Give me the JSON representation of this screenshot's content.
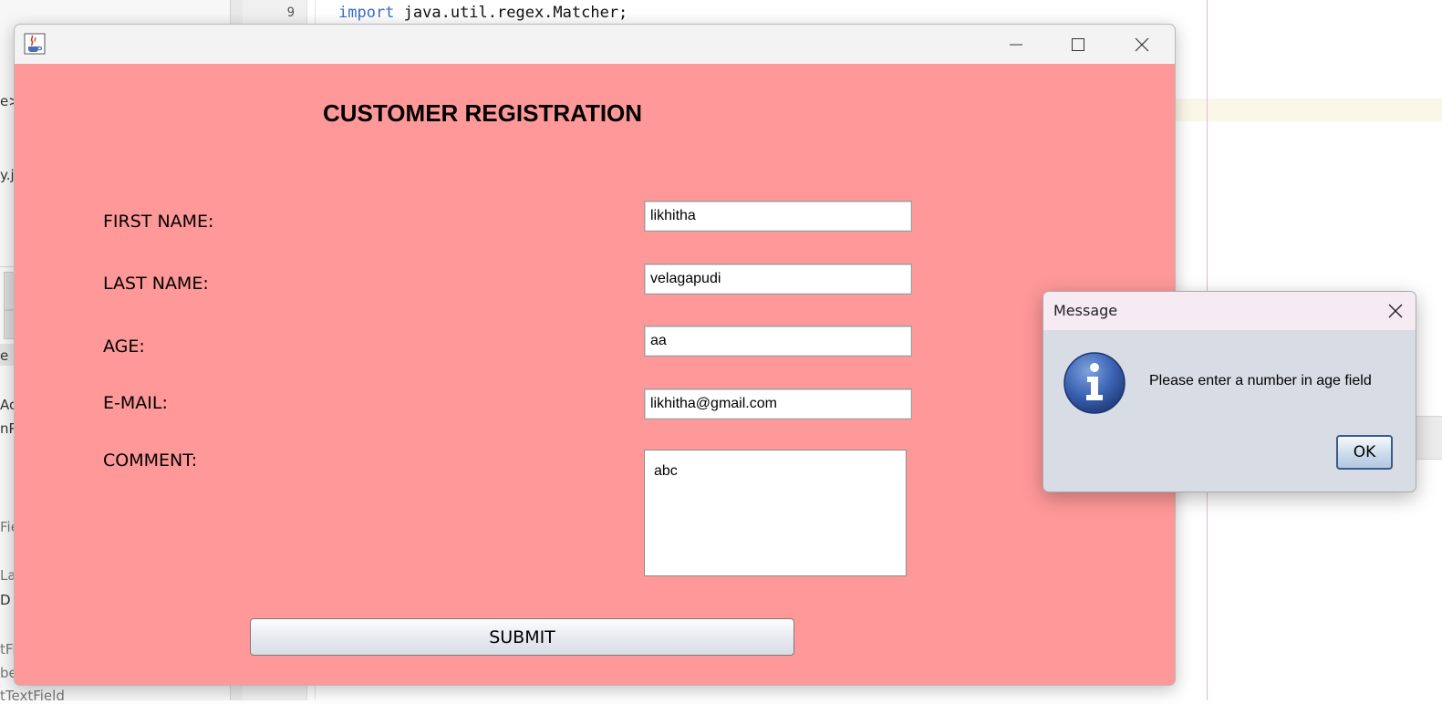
{
  "ide": {
    "left_fragments": [
      "e>",
      "y.j",
      "e",
      "Act",
      "nPa",
      "Fie",
      "Lab",
      "D",
      "tFie",
      "be",
      "tTextField"
    ],
    "line_number": "9",
    "code_keyword": "import",
    "code_rest": " java.util.regex.Matcher;"
  },
  "window": {
    "title": "",
    "icon": "java-coffee-cup-icon"
  },
  "form": {
    "heading": "CUSTOMER REGISTRATION",
    "first_name_label": "FIRST NAME:",
    "first_name_value": "likhitha",
    "last_name_label": "LAST NAME:",
    "last_name_value": "velagapudi",
    "age_label": "AGE:",
    "age_value": "aa",
    "email_label": "E-MAIL:",
    "email_value": "likhitha@gmail.com",
    "comment_label": "COMMENT:",
    "comment_value": "abc",
    "submit_label": "SUBMIT",
    "background_color": "#ff9898"
  },
  "dialog": {
    "title": "Message",
    "icon": "information-icon",
    "message": "Please enter a number in age field",
    "ok_label": "OK"
  }
}
